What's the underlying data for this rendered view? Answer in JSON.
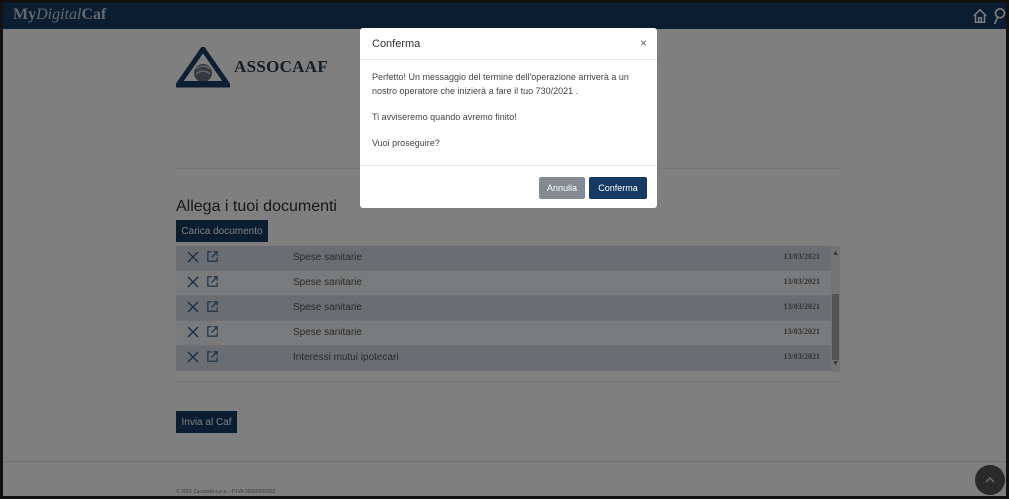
{
  "header": {
    "brand_prefix": "My",
    "brand_mid": "Digital",
    "brand_suffix": "Caf",
    "icons": [
      "home-icon",
      "user-icon"
    ]
  },
  "logo": {
    "text": "ASSOCAAF"
  },
  "documents": {
    "title": "Allega i tuoi documenti",
    "upload_label": "Carica documento",
    "rows": [
      {
        "name": "Spese sanitarie",
        "date": "13/03/2021"
      },
      {
        "name": "Spese sanitarie",
        "date": "13/03/2021"
      },
      {
        "name": "Spese sanitarie",
        "date": "13/03/2021"
      },
      {
        "name": "Spese sanitarie",
        "date": "13/03/2021"
      },
      {
        "name": "Interessi mutui ipotecari",
        "date": "13/03/2021"
      }
    ],
    "send_label": "Invia al Caf"
  },
  "footer": {
    "text": "© 2021 Zucchetti s.p.a. - P.IVA 05006900962"
  },
  "modal": {
    "title": "Conferma",
    "close_glyph": "×",
    "message_1": "Perfetto! Un messaggio del termine dell'operazione arriverà a un nostro operatore che inizierà a fare il tuo 730/2021 .",
    "message_2": "Ti avviseremo quando avremo finito!",
    "message_3": "Vuoi proseguire?",
    "cancel_label": "Annulla",
    "confirm_label": "Conferma"
  },
  "colors": {
    "primary": "#163a63",
    "row_odd": "#d4dde7",
    "row_even": "#f1f4f7",
    "cancel": "#838a91"
  }
}
